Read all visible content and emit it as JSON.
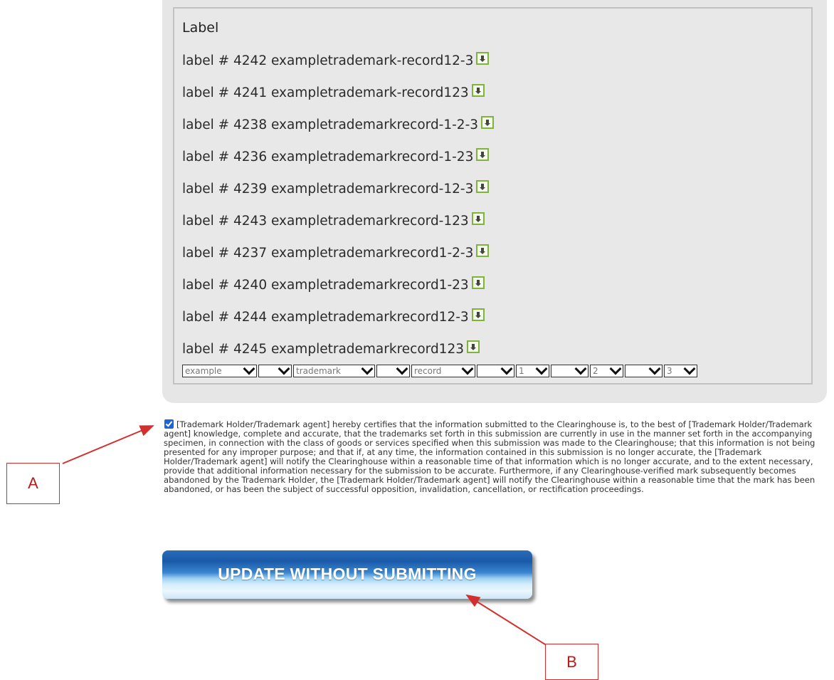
{
  "label_list": {
    "header": "Label",
    "items": [
      "label # 4242 exampletrademark-record12-3",
      "label # 4241 exampletrademark-record123",
      "label # 4238 exampletrademarkrecord-1-2-3",
      "label # 4236 exampletrademarkrecord-1-23",
      "label # 4239 exampletrademarkrecord-12-3",
      "label # 4243 exampletrademarkrecord-123",
      "label # 4237 exampletrademarkrecord1-2-3",
      "label # 4240 exampletrademarkrecord1-23",
      "label # 4244 exampletrademarkrecord12-3",
      "label # 4245 exampletrademarkrecord123"
    ],
    "item_icon": "download-icon",
    "selects": [
      "example",
      "",
      "trademark",
      "",
      "record",
      "",
      "1",
      "",
      "2",
      "",
      "3"
    ]
  },
  "certification": {
    "checked": true,
    "text": "[Trademark Holder/Trademark agent] hereby certifies that the information submitted to the Clearinghouse is, to the best of [Trademark Holder/Trademark agent] knowledge, complete and accurate, that the trademarks set forth in this submission are currently in use in the manner set forth in the accompanying specimen, in connection with the class of goods or services specified when this submission was made to the Clearinghouse; that this information is not being presented for any improper purpose; and that if, at any time, the information contained in this submission is no longer accurate, the [Trademark Holder/Trademark agent] will notify the Clearinghouse within a reasonable time of that information which is no longer accurate, and to the extent necessary, provide that additional information necessary for the submission to be accurate. Furthermore, if any Clearinghouse-verified mark subsequently becomes abandoned by the Trademark Holder, the [Trademark Holder/Trademark agent] will notify the Clearinghouse within a reasonable time that the mark has been abandoned, or has been the subject of successful opposition, invalidation, cancellation, or rectification proceedings."
  },
  "update_button": {
    "label": "UPDATE WITHOUT SUBMITTING"
  },
  "annotations": {
    "a": "A",
    "b": "B",
    "color": "#d32f2f"
  }
}
